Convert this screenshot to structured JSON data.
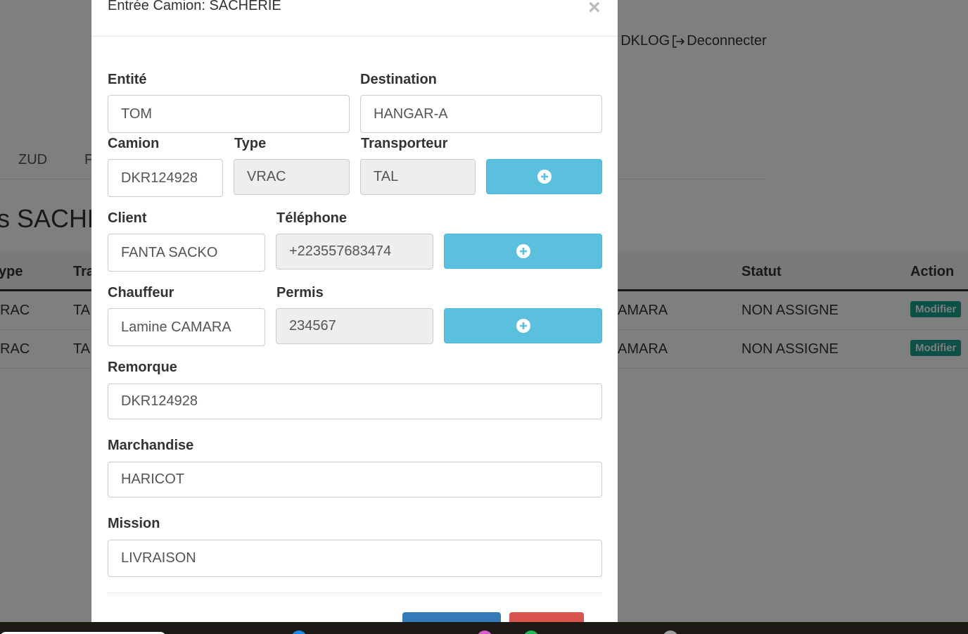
{
  "background": {
    "user": {
      "name_partial": "MIN DKLOG",
      "logout_label": "Deconnecter"
    },
    "tabs": [
      "ZUD",
      "F"
    ],
    "heading_partial": "s SACHE",
    "table": {
      "headers": {
        "type": "ype",
        "transporteur": "Tra",
        "statut": "Statut",
        "action": "Action"
      },
      "rows": [
        {
          "type": "RAC",
          "transporteur": "TA",
          "chauffeur": "AMARA",
          "statut": "NON ASSIGNE",
          "action": "Modifier"
        },
        {
          "type": "RAC",
          "transporteur": "TA",
          "chauffeur": "AMARA",
          "statut": "NON ASSIGNE",
          "action": "Modifier"
        }
      ]
    }
  },
  "modal": {
    "title": "Entrée Camion: SACHERIE",
    "close_symbol": "×",
    "fields": {
      "entite": {
        "label": "Entité",
        "value": "TOM"
      },
      "destination": {
        "label": "Destination",
        "value": "HANGAR-A"
      },
      "camion": {
        "label": "Camion",
        "value": "DKR124928"
      },
      "type": {
        "label": "Type",
        "value": "VRAC"
      },
      "transporteur": {
        "label": "Transporteur",
        "value": "TAL"
      },
      "client": {
        "label": "Client",
        "value": "FANTA SACKO"
      },
      "telephone": {
        "label": "Téléphone",
        "value": "+223557683474"
      },
      "chauffeur": {
        "label": "Chauffeur",
        "value": "Lamine CAMARA"
      },
      "permis": {
        "label": "Permis",
        "value": "234567"
      },
      "remorque": {
        "label": "Remorque",
        "value": "DKR124928"
      },
      "marchandise": {
        "label": "Marchandise",
        "value": "HARICOT"
      },
      "mission": {
        "label": "Mission",
        "value": "LIVRAISON"
      }
    },
    "icons": {
      "add": "plus-circle-icon",
      "close": "close-icon",
      "logout": "logout-icon"
    }
  },
  "colors": {
    "info_button": "#5bc0de",
    "primary_button": "#337ab7",
    "danger_button": "#d9534f",
    "modifier_badge": "#1aa091",
    "overlay": "rgba(0,0,0,0.5)"
  }
}
